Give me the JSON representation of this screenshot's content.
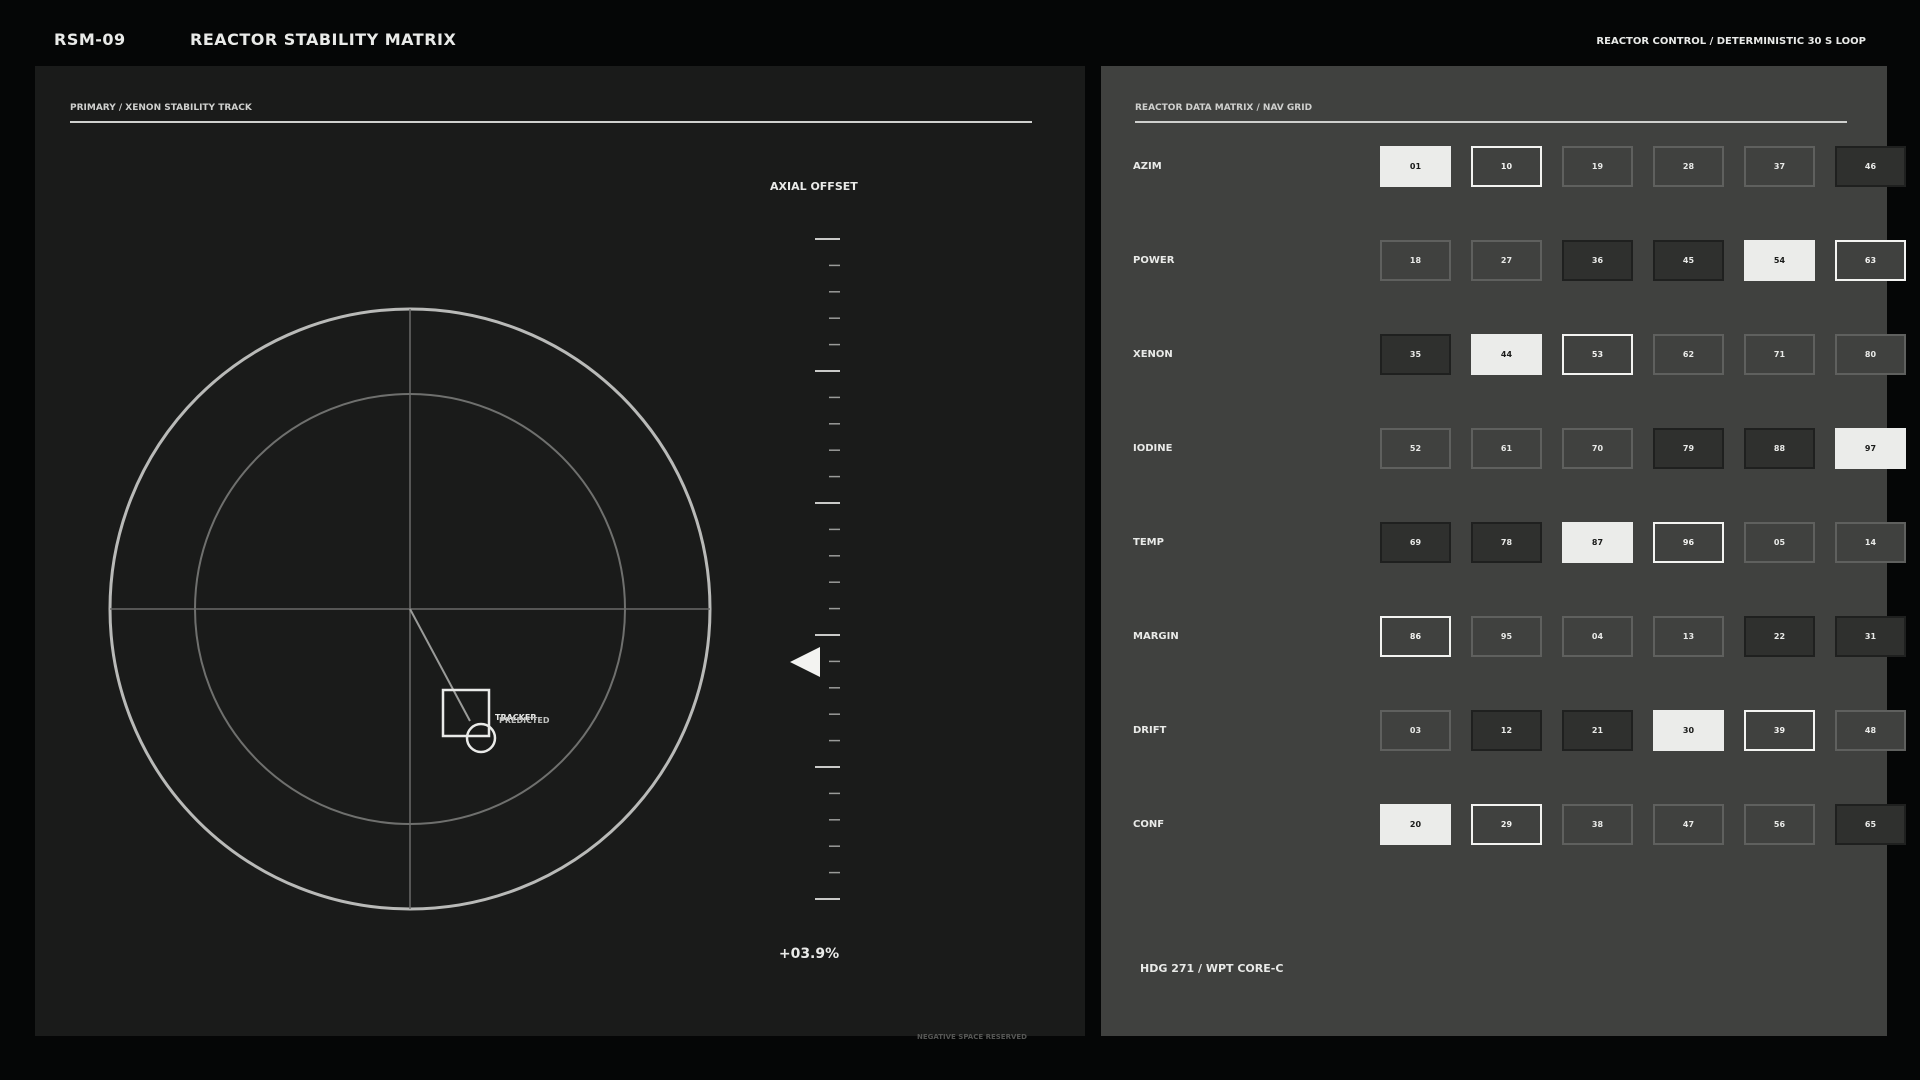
{
  "header": {
    "code": "RSM-09",
    "title": "REACTOR STABILITY MATRIX",
    "mode": "REACTOR CONTROL / DETERMINISTIC 30 S LOOP"
  },
  "left_panel": {
    "section_label": "PRIMARY / XENON STABILITY TRACK",
    "tracker_label": "TRACKER",
    "predicted_label": "PREDICTED",
    "axial_label": "AXIAL OFFSET",
    "axial_value": "+03.9%",
    "footer_note": "NEGATIVE SPACE RESERVED"
  },
  "right_panel": {
    "section_label": "REACTOR DATA MATRIX / NAV GRID",
    "footer": "HDG 271 / WPT CORE-C",
    "rows": [
      {
        "label": "AZIM",
        "cells": [
          {
            "v": "01",
            "s": "filled"
          },
          {
            "v": "10",
            "s": "outline"
          },
          {
            "v": "19",
            "s": "plain"
          },
          {
            "v": "28",
            "s": "plain"
          },
          {
            "v": "37",
            "s": "plain"
          },
          {
            "v": "46",
            "s": "dim"
          }
        ]
      },
      {
        "label": "POWER",
        "cells": [
          {
            "v": "18",
            "s": "plain"
          },
          {
            "v": "27",
            "s": "plain"
          },
          {
            "v": "36",
            "s": "dim"
          },
          {
            "v": "45",
            "s": "dim"
          },
          {
            "v": "54",
            "s": "filled"
          },
          {
            "v": "63",
            "s": "outline"
          }
        ]
      },
      {
        "label": "XENON",
        "cells": [
          {
            "v": "35",
            "s": "dim"
          },
          {
            "v": "44",
            "s": "filled"
          },
          {
            "v": "53",
            "s": "outline"
          },
          {
            "v": "62",
            "s": "plain"
          },
          {
            "v": "71",
            "s": "plain"
          },
          {
            "v": "80",
            "s": "plain"
          }
        ]
      },
      {
        "label": "IODINE",
        "cells": [
          {
            "v": "52",
            "s": "plain"
          },
          {
            "v": "61",
            "s": "plain"
          },
          {
            "v": "70",
            "s": "plain"
          },
          {
            "v": "79",
            "s": "dim"
          },
          {
            "v": "88",
            "s": "dim"
          },
          {
            "v": "97",
            "s": "filled"
          }
        ]
      },
      {
        "label": "TEMP",
        "cells": [
          {
            "v": "69",
            "s": "dim"
          },
          {
            "v": "78",
            "s": "dim"
          },
          {
            "v": "87",
            "s": "filled"
          },
          {
            "v": "96",
            "s": "outline"
          },
          {
            "v": "05",
            "s": "plain"
          },
          {
            "v": "14",
            "s": "plain"
          }
        ]
      },
      {
        "label": "MARGIN",
        "cells": [
          {
            "v": "86",
            "s": "outline"
          },
          {
            "v": "95",
            "s": "plain"
          },
          {
            "v": "04",
            "s": "plain"
          },
          {
            "v": "13",
            "s": "plain"
          },
          {
            "v": "22",
            "s": "dim"
          },
          {
            "v": "31",
            "s": "dim"
          }
        ]
      },
      {
        "label": "DRIFT",
        "cells": [
          {
            "v": "03",
            "s": "plain"
          },
          {
            "v": "12",
            "s": "dim"
          },
          {
            "v": "21",
            "s": "dim"
          },
          {
            "v": "30",
            "s": "filled"
          },
          {
            "v": "39",
            "s": "outline"
          },
          {
            "v": "48",
            "s": "plain"
          }
        ]
      },
      {
        "label": "CONF",
        "cells": [
          {
            "v": "20",
            "s": "filled"
          },
          {
            "v": "29",
            "s": "outline"
          },
          {
            "v": "38",
            "s": "plain"
          },
          {
            "v": "47",
            "s": "plain"
          },
          {
            "v": "56",
            "s": "plain"
          },
          {
            "v": "65",
            "s": "dim"
          }
        ]
      }
    ]
  }
}
